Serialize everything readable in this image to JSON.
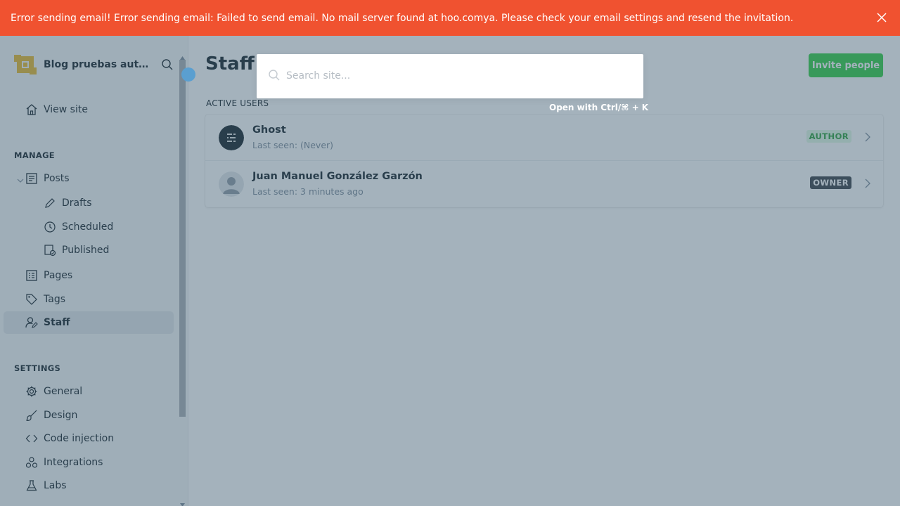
{
  "alert": {
    "message": "Error sending email! Error sending email: Failed to send email. No mail server found at hoo.comya. Please check your email settings and resend the invitation."
  },
  "sidebar": {
    "site_name": "Blog pruebas auto...",
    "view_site": "View site",
    "manage_header": "MANAGE",
    "posts": "Posts",
    "drafts": "Drafts",
    "scheduled": "Scheduled",
    "published": "Published",
    "pages": "Pages",
    "tags": "Tags",
    "staff": "Staff",
    "settings_header": "SETTINGS",
    "general": "General",
    "design": "Design",
    "code_injection": "Code injection",
    "integrations": "Integrations",
    "labs": "Labs"
  },
  "main": {
    "title": "Staff users",
    "invite_button": "Invite people",
    "active_users_header": "ACTIVE USERS",
    "users": [
      {
        "name": "Ghost",
        "last_seen": "Last seen: (Never)",
        "role": "AUTHOR"
      },
      {
        "name": "Juan Manuel González Garzón",
        "last_seen": "Last seen: 3 minutes ago",
        "role": "OWNER"
      }
    ]
  },
  "search": {
    "placeholder": "Search site...",
    "shortcut_hint": "Open with Ctrl/⌘ + K"
  },
  "colors": {
    "alert": "#f05230",
    "accent_green": "#30cf43",
    "overlay": "#415f73"
  }
}
